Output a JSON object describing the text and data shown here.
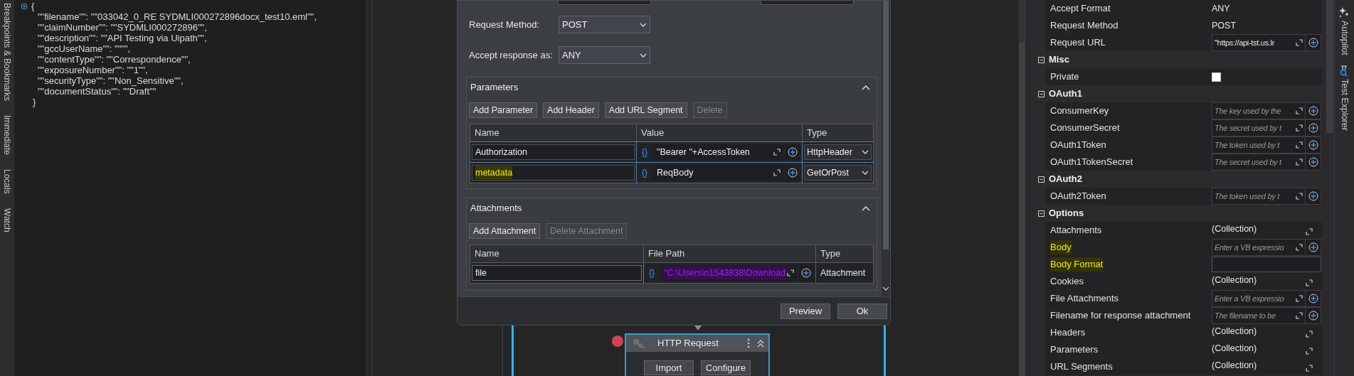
{
  "left_tabs": [
    "Breakpoints & Bookmarks",
    "Immediate",
    "Locals",
    "Watch"
  ],
  "code": {
    "open": "{",
    "entries": [
      "\"\"filename\"\": \"\"033042_0_RE SYDMLI000272896docx_test10.eml\"\",",
      "\"\"claimNumber\"\": \"\"SYDMLI000272896\"\",",
      "\"\"description\"\": \"\"API Testing via Uipath\"\",",
      "\"\"gccUserName\"\": \"\"\"\",",
      "\"\"contentType\"\": \"\"Correspondence\"\",",
      "\"\"exposureNumber\"\": \"\"1\"\",",
      "\"\"securityType\"\": \"\"Non_Sensitive\"\",",
      "\"\"documentStatus\"\": \"\"Draft\"\""
    ],
    "close": "}"
  },
  "dialog": {
    "fields": [
      {
        "label": "Request Method:",
        "value": "POST"
      },
      {
        "label": "Accept response as:",
        "value": "ANY"
      }
    ],
    "parameters": {
      "title": "Parameters",
      "expanded": true,
      "buttons": [
        {
          "label": "Add Parameter",
          "disabled": false
        },
        {
          "label": "Add Header",
          "disabled": false
        },
        {
          "label": "Add URL Segment",
          "disabled": false
        },
        {
          "label": "Delete",
          "disabled": true
        }
      ],
      "columns": [
        "Name",
        "Value",
        "Type"
      ],
      "rows": [
        {
          "name": "Authorization",
          "marked": false,
          "prefix": "{}",
          "value": "\"Bearer \"+AccessToken",
          "type": "HttpHeader"
        },
        {
          "name": "metadata",
          "marked": true,
          "prefix": "{}",
          "value": "ReqBody",
          "type": "GetOrPost"
        }
      ]
    },
    "attachments": {
      "title": "Attachments",
      "expanded": true,
      "buttons": [
        {
          "label": "Add Attachment",
          "disabled": false
        },
        {
          "label": "Delete Attachment",
          "disabled": true
        }
      ],
      "columns": [
        "Name",
        "File Path",
        "Type"
      ],
      "rows": [
        {
          "name": "file",
          "prefix": "{}",
          "path": "\"C:\\Users\\n1543838\\Download",
          "marked": true,
          "type": "Attachment"
        }
      ]
    },
    "footer_buttons": [
      "Preview",
      "Ok"
    ]
  },
  "activity": {
    "title": "HTTP Request",
    "breakpoint": true,
    "buttons": [
      "Import",
      "Configure"
    ]
  },
  "properties": {
    "top_rows": [
      {
        "label": "Accept Format",
        "kind": "text",
        "value": "ANY"
      },
      {
        "label": "Request Method",
        "kind": "text",
        "value": "POST"
      },
      {
        "label": "Request URL",
        "kind": "field",
        "value": "\"https://api-tst.us.lr"
      }
    ],
    "categories": [
      {
        "title": "Misc",
        "expanded": true,
        "rows": [
          {
            "label": "Private",
            "kind": "checkbox",
            "checked": false
          }
        ]
      },
      {
        "title": "OAuth1",
        "expanded": true,
        "rows": [
          {
            "label": "ConsumerKey",
            "kind": "field",
            "placeholder": "The key used by the"
          },
          {
            "label": "ConsumerSecret",
            "kind": "field",
            "placeholder": "The secret used by t"
          },
          {
            "label": "OAuth1Token",
            "kind": "field",
            "placeholder": "The token used by t"
          },
          {
            "label": "OAuth1TokenSecret",
            "kind": "field",
            "placeholder": "The secret used by t"
          }
        ]
      },
      {
        "title": "OAuth2",
        "expanded": true,
        "rows": [
          {
            "label": "OAuth2Token",
            "kind": "field",
            "placeholder": "The token used by t"
          }
        ]
      },
      {
        "title": "Options",
        "expanded": true,
        "rows": [
          {
            "label": "Attachments",
            "kind": "collection",
            "value": "(Collection)"
          },
          {
            "label": "Body",
            "kind": "field",
            "placeholder": "Enter a VB expressio",
            "marked": true
          },
          {
            "label": "Body Format",
            "kind": "box",
            "marked": true
          },
          {
            "label": "Cookies",
            "kind": "collection",
            "value": "(Collection)"
          },
          {
            "label": "File Attachments",
            "kind": "field",
            "placeholder": "Enter a VB expressio"
          },
          {
            "label": "Filename for response attachment",
            "kind": "field",
            "placeholder": "The filename to be"
          },
          {
            "label": "Headers",
            "kind": "collection",
            "value": "(Collection)"
          },
          {
            "label": "Parameters",
            "kind": "collection",
            "value": "(Collection)"
          },
          {
            "label": "URL Segments",
            "kind": "collection",
            "value": "(Collection)"
          }
        ]
      }
    ]
  },
  "right_tabs": [
    "Autopilot",
    "Test Explorer"
  ]
}
